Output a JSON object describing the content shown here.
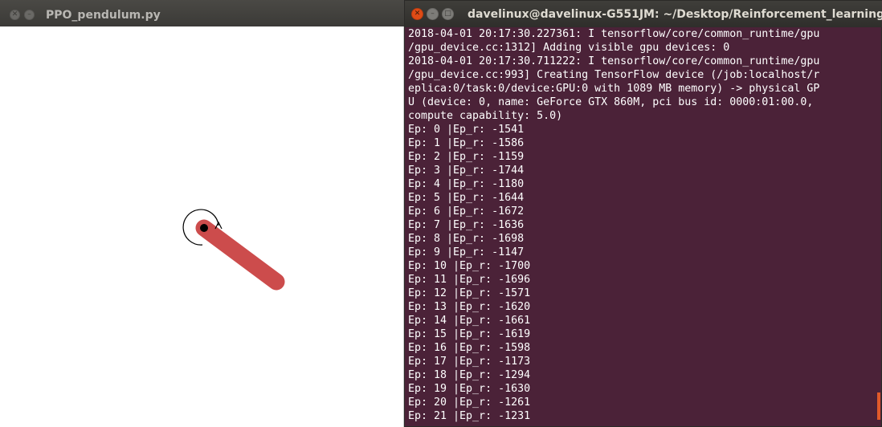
{
  "pendulum_window": {
    "title": "PPO_pendulum.py",
    "pole_color": "#cc4c4c",
    "pole_angle_deg": 37
  },
  "terminal": {
    "title": "davelinux@davelinux-G551JM: ~/Desktop/Reinforcement_learning",
    "background": "#4b2238",
    "lines": [
      "2018-04-01 20:17:30.227361: I tensorflow/core/common_runtime/gpu",
      "/gpu_device.cc:1312] Adding visible gpu devices: 0",
      "2018-04-01 20:17:30.711222: I tensorflow/core/common_runtime/gpu",
      "/gpu_device.cc:993] Creating TensorFlow device (/job:localhost/r",
      "eplica:0/task:0/device:GPU:0 with 1089 MB memory) -> physical GP",
      "U (device: 0, name: GeForce GTX 860M, pci bus id: 0000:01:00.0,",
      "compute capability: 5.0)",
      "Ep: 0 |Ep_r: -1541",
      "Ep: 1 |Ep_r: -1586",
      "Ep: 2 |Ep_r: -1159",
      "Ep: 3 |Ep_r: -1744",
      "Ep: 4 |Ep_r: -1180",
      "Ep: 5 |Ep_r: -1644",
      "Ep: 6 |Ep_r: -1672",
      "Ep: 7 |Ep_r: -1636",
      "Ep: 8 |Ep_r: -1698",
      "Ep: 9 |Ep_r: -1147",
      "Ep: 10 |Ep_r: -1700",
      "Ep: 11 |Ep_r: -1696",
      "Ep: 12 |Ep_r: -1571",
      "Ep: 13 |Ep_r: -1620",
      "Ep: 14 |Ep_r: -1661",
      "Ep: 15 |Ep_r: -1619",
      "Ep: 16 |Ep_r: -1598",
      "Ep: 17 |Ep_r: -1173",
      "Ep: 18 |Ep_r: -1294",
      "Ep: 19 |Ep_r: -1630",
      "Ep: 20 |Ep_r: -1261",
      "Ep: 21 |Ep_r: -1231"
    ]
  }
}
